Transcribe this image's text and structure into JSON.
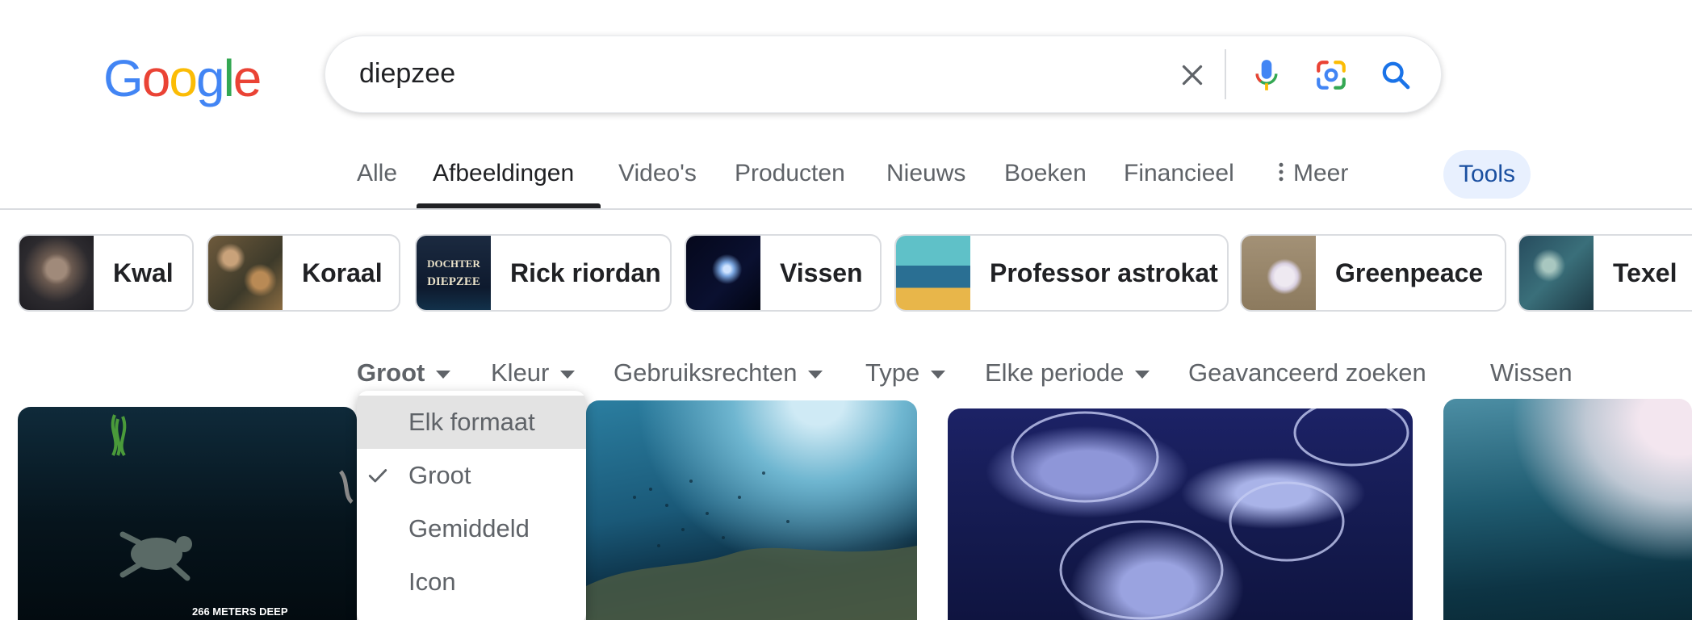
{
  "header": {
    "logo_letters": [
      "G",
      "o",
      "o",
      "g",
      "l",
      "e"
    ],
    "logo_colors": [
      "#4285F4",
      "#EA4335",
      "#FBBC05",
      "#4285F4",
      "#34A853",
      "#EA4335"
    ],
    "search_query": "diepzee"
  },
  "icons": {
    "clear": "close-icon",
    "voice": "microphone-icon",
    "lens": "camera-lens-icon",
    "search": "search-icon"
  },
  "tabs": [
    {
      "label": "Alle"
    },
    {
      "label": "Afbeeldingen",
      "active": true
    },
    {
      "label": "Video's"
    },
    {
      "label": "Producten"
    },
    {
      "label": "Nieuws"
    },
    {
      "label": "Boeken"
    },
    {
      "label": "Financieel"
    },
    {
      "label": "Meer"
    }
  ],
  "tools_label": "Tools",
  "chips": [
    {
      "label": "Kwal"
    },
    {
      "label": "Koraal"
    },
    {
      "label": "Rick riordan"
    },
    {
      "label": "Vissen"
    },
    {
      "label": "Professor astrokat"
    },
    {
      "label": "Greenpeace"
    },
    {
      "label": "Texel"
    }
  ],
  "filters": [
    {
      "label": "Groot",
      "active": true
    },
    {
      "label": "Kleur"
    },
    {
      "label": "Gebruiksrechten"
    },
    {
      "label": "Type"
    },
    {
      "label": "Elke periode"
    },
    {
      "label": "Geavanceerd zoeken"
    },
    {
      "label": "Wissen"
    }
  ],
  "size_dropdown": {
    "options": [
      {
        "label": "Elk formaat",
        "highlighted": true
      },
      {
        "label": "Groot",
        "selected": true
      },
      {
        "label": "Gemiddeld"
      },
      {
        "label": "Icon"
      }
    ]
  },
  "image_texts": {
    "depth_label": "266 METERS DEEP",
    "book_title_line1": "DOCHTER",
    "book_title_line2": "DIEPZEE"
  },
  "colors": {
    "accent_blue": "#1a73e8",
    "tools_bg": "#e8f0fe",
    "text_primary": "#202124",
    "text_secondary": "#5f6368"
  }
}
